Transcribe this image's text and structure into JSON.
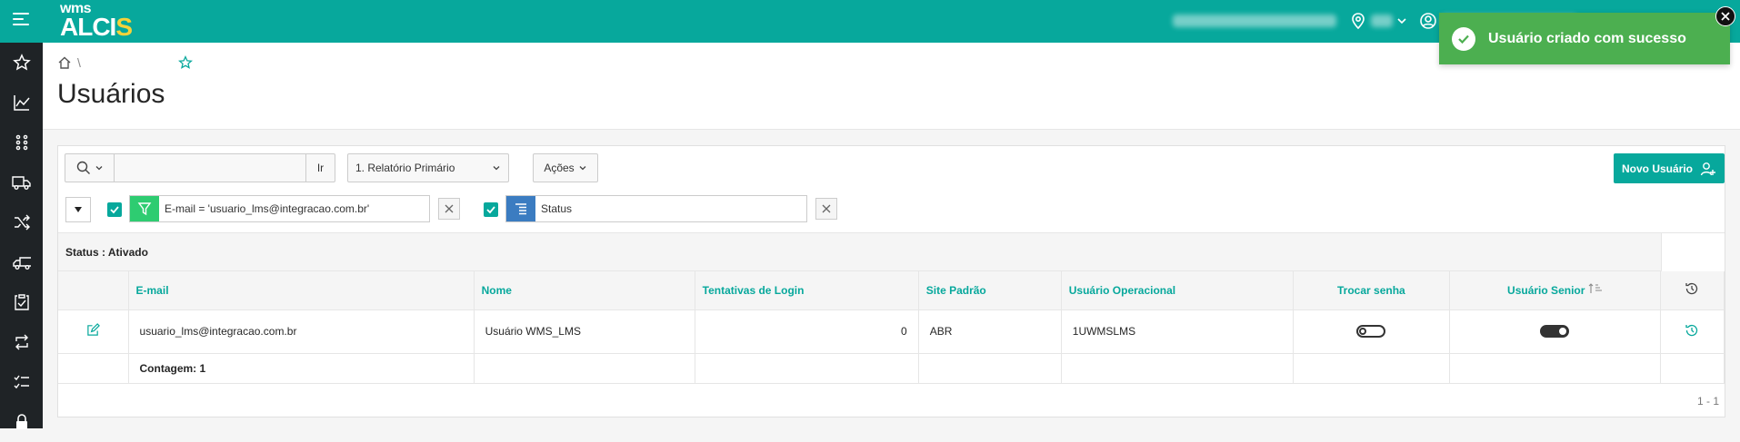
{
  "app": {
    "logo_top": "wms",
    "logo_main_a": "ALCI",
    "logo_main_b": "S"
  },
  "colors": {
    "brand": "#07a89c",
    "sidebar": "#1f2326",
    "toast": "#4caf50"
  },
  "topbar": {
    "icons": [
      "menu-icon",
      "location-icon",
      "user-circle-icon",
      "search-icon",
      "senior-logo"
    ]
  },
  "sidebar": {
    "items": [
      "star-icon",
      "chart-line-icon",
      "apps-grid-icon",
      "truck-icon",
      "shuffle-icon",
      "delivery-truck-icon",
      "clipboard-check-icon",
      "refresh-arrows-icon",
      "checklist-icon",
      "lock-icon"
    ]
  },
  "breadcrumb": {
    "separator": "\\"
  },
  "page": {
    "title": "Usuários"
  },
  "toolbar": {
    "search_placeholder": "",
    "go_label": "Ir",
    "report_select": "1. Relatório Primário",
    "actions_label": "Ações",
    "new_user_label": "Novo Usuário"
  },
  "filters": [
    {
      "label": "E-mail = 'usuario_lms@integracao.com.br'",
      "type": "filter"
    },
    {
      "label": "Status",
      "type": "group"
    }
  ],
  "group": {
    "label": "Status : Ativado"
  },
  "table": {
    "columns": [
      "E-mail",
      "Nome",
      "Tentativas de Login",
      "Site Padrão",
      "Usuário Operacional",
      "Trocar senha",
      "Usuário Senior"
    ],
    "rows": [
      {
        "email": "usuario_lms@integracao.com.br",
        "nome": "Usuário WMS_LMS",
        "tentativas": "0",
        "site": "ABR",
        "operacional": "1UWMSLMS",
        "trocar_senha": false,
        "usuario_senior": true
      }
    ],
    "count_label": "Contagem: 1"
  },
  "pagination": {
    "label": "1 - 1"
  },
  "toast": {
    "message": "Usuário criado com sucesso"
  }
}
